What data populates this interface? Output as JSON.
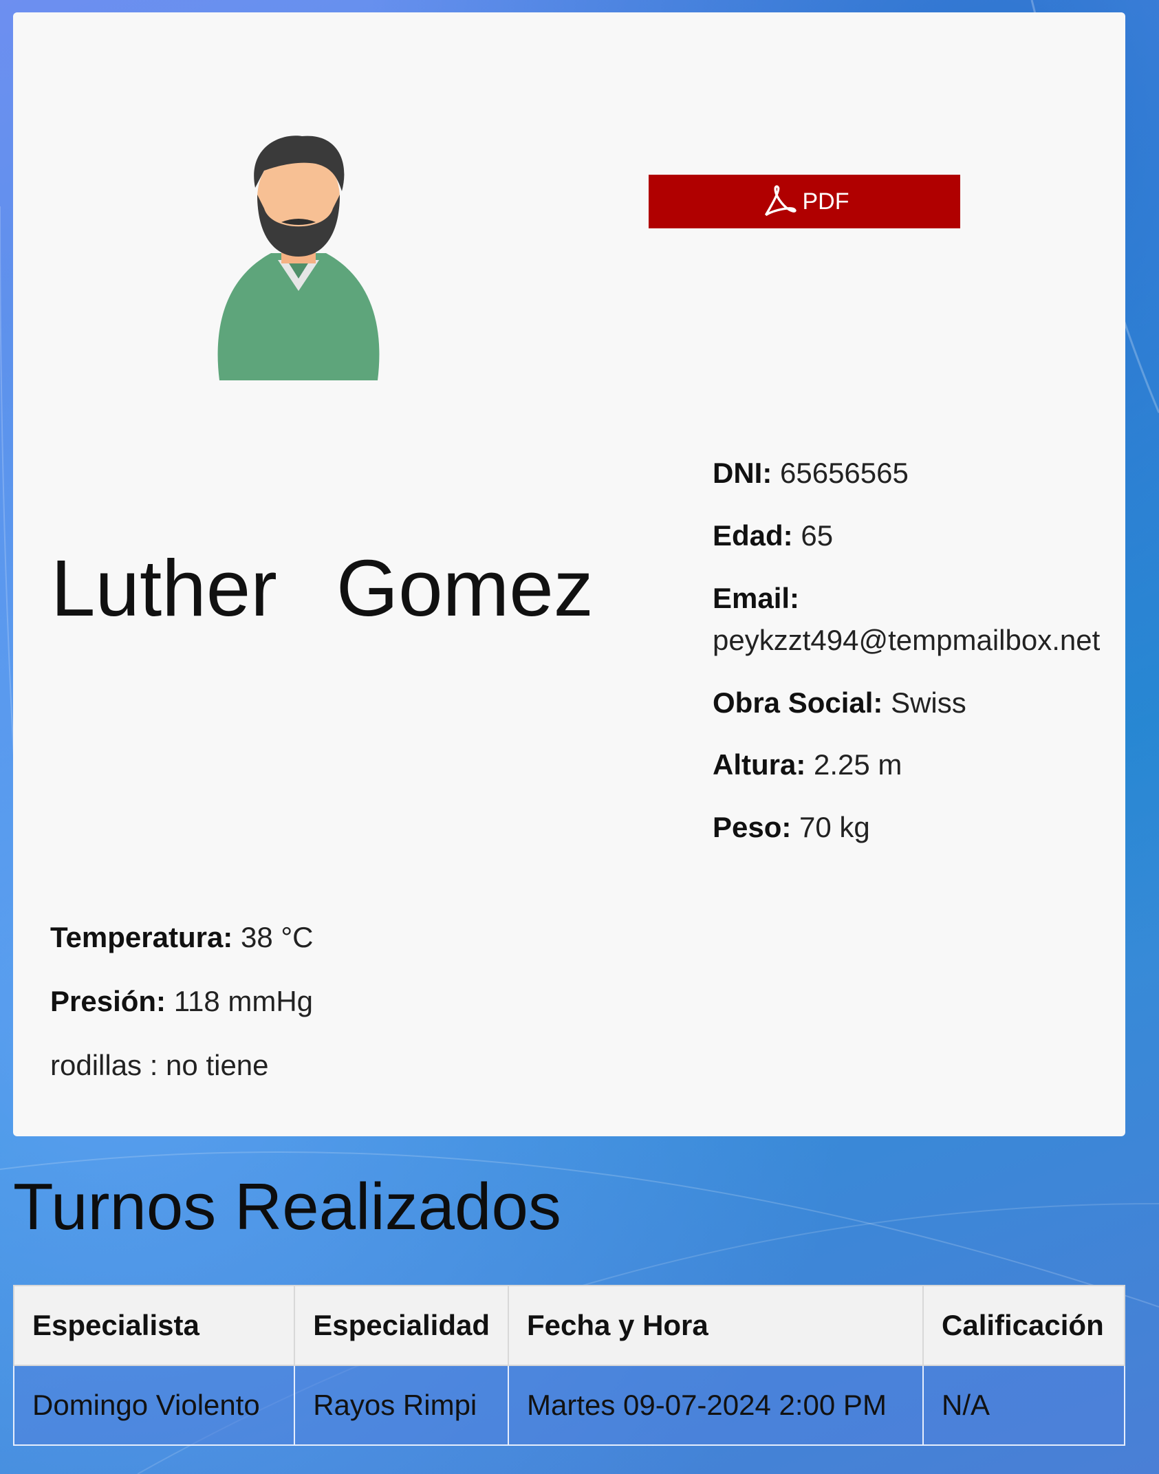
{
  "profile": {
    "first_name": "Luther",
    "last_name": "Gomez",
    "pdf_label": "PDF",
    "info": {
      "dni_label": "DNI:",
      "dni_value": "65656565",
      "edad_label": "Edad:",
      "edad_value": "65",
      "email_label": "Email:",
      "email_value": "peykzzt494@tempmailbox.net",
      "obra_label": "Obra Social:",
      "obra_value": "Swiss",
      "altura_label": "Altura:",
      "altura_value": "2.25 m",
      "peso_label": "Peso:",
      "peso_value": "70 kg"
    },
    "vitals": {
      "temp_label": "Temperatura:",
      "temp_value": "38 °C",
      "presion_label": "Presión:",
      "presion_value": "118 mmHg",
      "extra": "rodillas : no tiene"
    }
  },
  "turnos": {
    "title": "Turnos Realizados",
    "headers": [
      "Especialista",
      "Especialidad",
      "Fecha y Hora",
      "Calificación"
    ],
    "rows": [
      [
        "Domingo Violento",
        "Rayos Rimpi",
        "Martes 09-07-2024 2:00 PM",
        "N/A"
      ]
    ]
  },
  "colors": {
    "pdf_button": "#b00000",
    "card_bg": "#f8f8f8",
    "avatar_shirt": "#5ea57b"
  },
  "icons": {
    "avatar": "user-avatar-icon",
    "pdf": "acrobat-pdf-icon"
  }
}
